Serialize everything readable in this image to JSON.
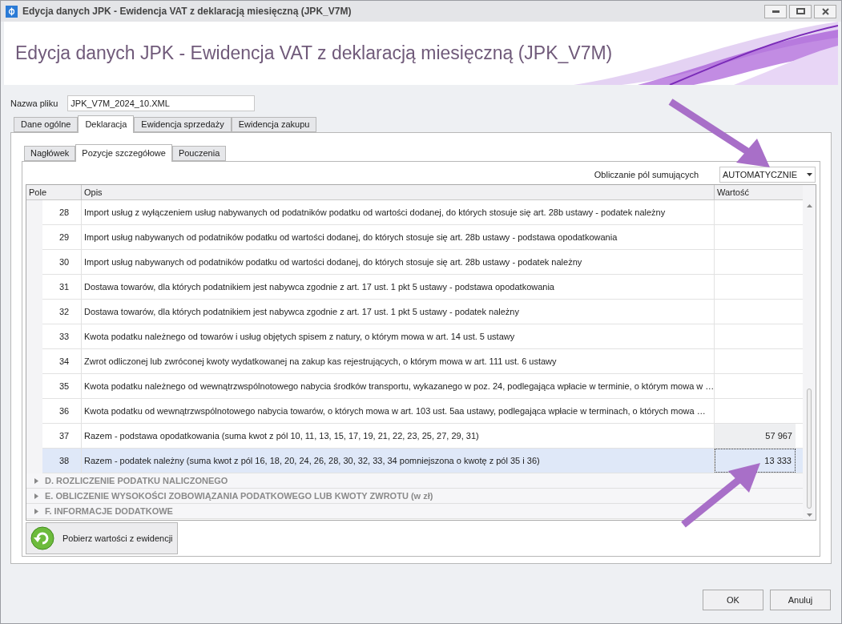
{
  "window": {
    "title": "Edycja danych JPK - Ewidencja VAT z deklaracją miesięczną (JPK_V7M)"
  },
  "header": {
    "title": "Edycja danych JPK - Ewidencja VAT z deklaracją miesięczną (JPK_V7M)"
  },
  "file_name": {
    "label": "Nazwa pliku",
    "value": "JPK_V7M_2024_10.XML"
  },
  "tabs": [
    {
      "label": "Dane ogólne",
      "selected": false
    },
    {
      "label": "Deklaracja",
      "selected": true
    },
    {
      "label": "Ewidencja sprzedaży",
      "selected": false
    },
    {
      "label": "Ewidencja zakupu",
      "selected": false
    }
  ],
  "subtabs": [
    {
      "label": "Nagłówek",
      "selected": false
    },
    {
      "label": "Pozycje szczegółowe",
      "selected": true
    },
    {
      "label": "Pouczenia",
      "selected": false
    }
  ],
  "summing": {
    "label": "Obliczanie pól sumujących",
    "value": "AUTOMATYCZNIE"
  },
  "table": {
    "columns": [
      "Pole",
      "Opis",
      "Wartość"
    ],
    "rows": [
      {
        "field": "28",
        "description": "Import usług z wyłączeniem usług nabywanych od podatników podatku od wartości dodanej, do których stosuje się art. 28b ustawy - podatek należny",
        "value": "",
        "computed": false,
        "selected": false
      },
      {
        "field": "29",
        "description": "Import usług nabywanych od podatników podatku od wartości dodanej, do których stosuje się art. 28b ustawy - podstawa opodatkowania",
        "value": "",
        "computed": false,
        "selected": false
      },
      {
        "field": "30",
        "description": "Import usług nabywanych od podatników podatku od wartości dodanej, do których stosuje się art. 28b ustawy - podatek należny",
        "value": "",
        "computed": false,
        "selected": false
      },
      {
        "field": "31",
        "description": "Dostawa towarów, dla których podatnikiem jest nabywca zgodnie z art. 17 ust. 1 pkt 5 ustawy - podstawa opodatkowania",
        "value": "",
        "computed": false,
        "selected": false
      },
      {
        "field": "32",
        "description": "Dostawa towarów, dla których podatnikiem jest nabywca zgodnie z art. 17 ust. 1 pkt 5 ustawy - podatek należny",
        "value": "",
        "computed": false,
        "selected": false
      },
      {
        "field": "33",
        "description": "Kwota podatku należnego od towarów i usług objętych spisem z natury, o którym mowa w art. 14 ust. 5 ustawy",
        "value": "",
        "computed": false,
        "selected": false
      },
      {
        "field": "34",
        "description": "Zwrot odliczonej lub zwróconej kwoty wydatkowanej na zakup kas rejestrujących, o którym mowa w art. 111 ust. 6 ustawy",
        "value": "",
        "computed": false,
        "selected": false
      },
      {
        "field": "35",
        "description": "Kwota podatku należnego od wewnątrzwspólnotowego nabycia środków transportu, wykazanego w poz. 24, podlegająca wpłacie w terminie, o którym mowa w …",
        "value": "",
        "computed": false,
        "selected": false
      },
      {
        "field": "36",
        "description": "Kwota podatku od wewnątrzwspólnotowego nabycia towarów, o których mowa w art. 103 ust. 5aa ustawy, podlegająca wpłacie w terminach, o których mowa …",
        "value": "",
        "computed": false,
        "selected": false
      },
      {
        "field": "37",
        "description": "Razem - podstawa opodatkowania (suma kwot z pól 10, 11, 13, 15, 17, 19, 21, 22, 23, 25, 27, 29, 31)",
        "value": "57 967",
        "computed": true,
        "selected": false
      },
      {
        "field": "38",
        "description": "Razem - podatek należny (suma kwot z pól 16, 18, 20, 24, 26, 28, 30, 32, 33, 34 pomniejszona o kwotę z pól 35 i 36)",
        "value": "13 333",
        "computed": true,
        "selected": true
      }
    ],
    "groups": [
      {
        "label": "D. ROZLICZENIE PODATKU NALICZONEGO",
        "expanded": false
      },
      {
        "label": "E. OBLICZENIE WYSOKOŚCI ZOBOWIĄZANIA PODATKOWEGO LUB KWOTY ZWROTU (w zł)",
        "expanded": false
      },
      {
        "label": "F. INFORMACJE DODATKOWE",
        "expanded": false
      }
    ]
  },
  "fetch_button": {
    "label": "Pobierz wartości z ewidencji"
  },
  "buttons": [
    "OK",
    "Anuluj"
  ]
}
